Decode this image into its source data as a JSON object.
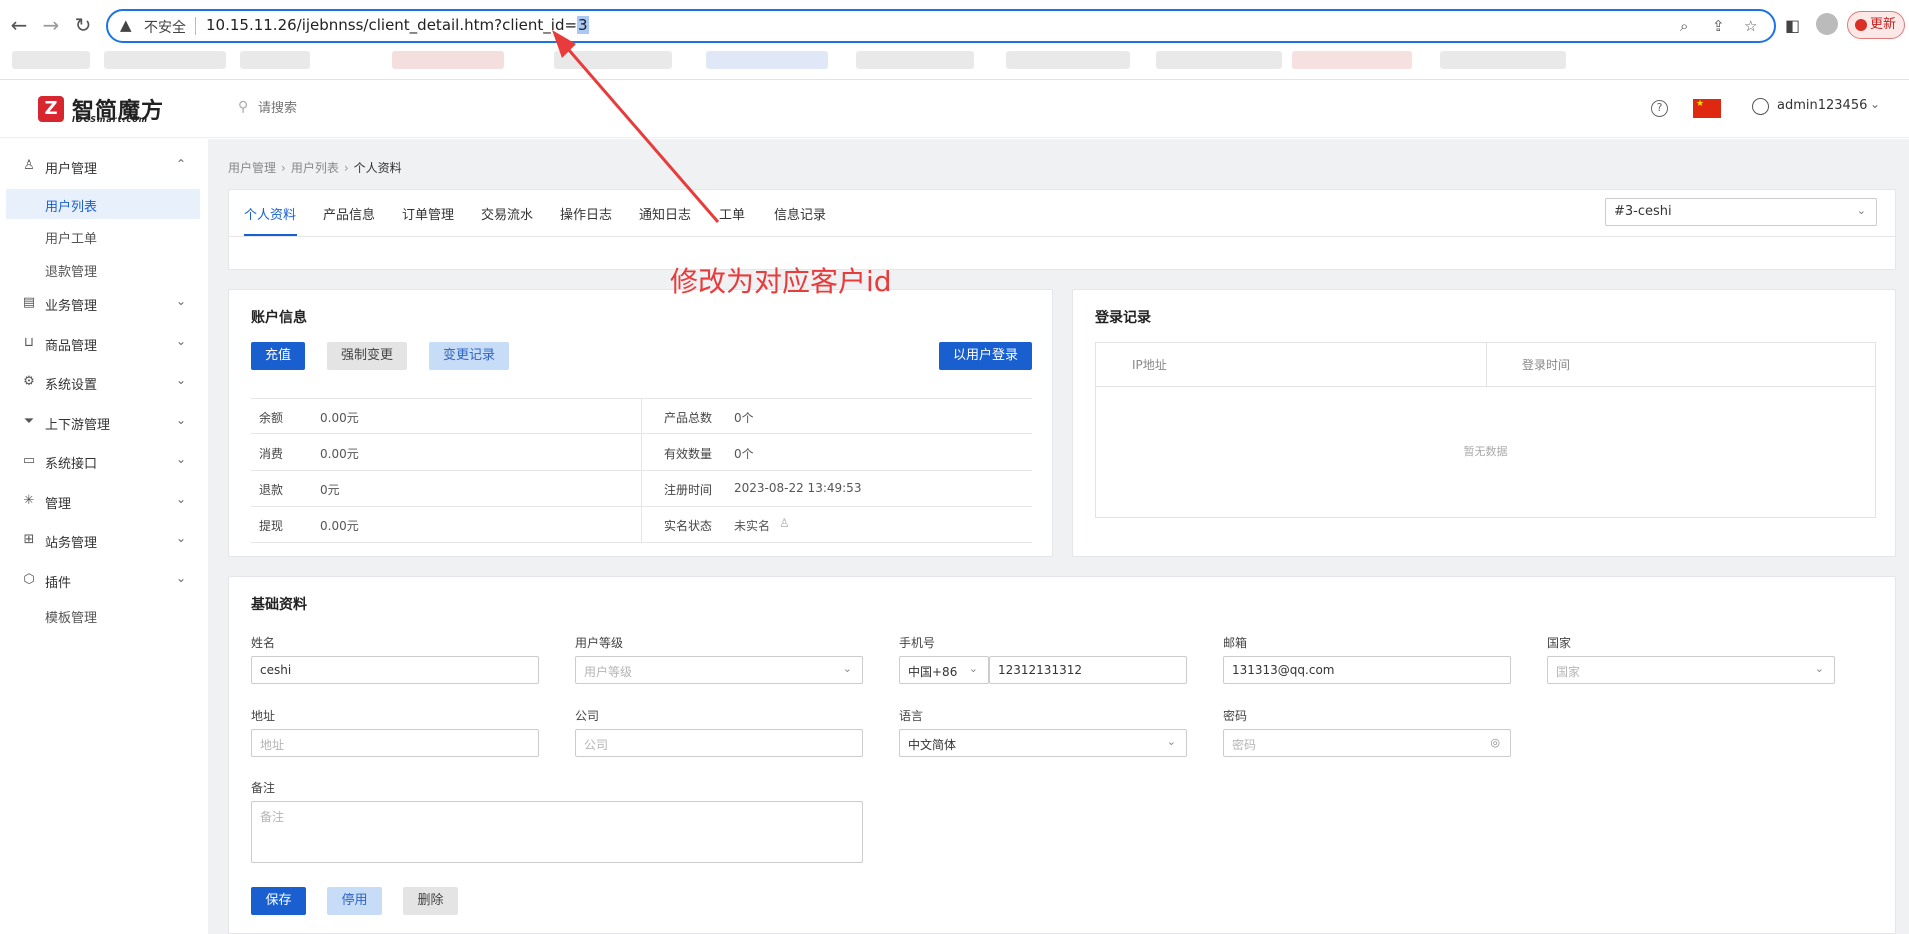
{
  "browser": {
    "insecure_label": "不安全",
    "url_prefix": "10.15.11.26/ijebnnss/client_detail.htm?client_id=",
    "url_selected": "3",
    "update_label": "更新"
  },
  "header": {
    "logo_text": "智简魔方",
    "logo_sub": "IDCSmart.com",
    "search_placeholder": "请搜索",
    "username": "admin123456"
  },
  "sidebar": {
    "user_mgmt": "用户管理",
    "user_list": "用户列表",
    "user_tickets": "用户工单",
    "refund_mgmt": "退款管理",
    "groups": [
      "业务管理",
      "商品管理",
      "系统设置",
      "上下游管理",
      "系统接口",
      "管理",
      "站务管理",
      "插件"
    ],
    "template_mgmt": "模板管理"
  },
  "breadcrumb": {
    "level1": "用户管理",
    "level2": "用户列表",
    "current": "个人资料"
  },
  "tabs": [
    "个人资料",
    "产品信息",
    "订单管理",
    "交易流水",
    "操作日志",
    "通知日志",
    "工单",
    "信息记录"
  ],
  "client_select": "#3-ceshi",
  "account": {
    "title": "账户信息",
    "btn_recharge": "充值",
    "btn_force_change": "强制变更",
    "btn_change_log": "变更记录",
    "btn_login_as": "以用户登录",
    "left": [
      {
        "k": "余额",
        "v": "0.00元"
      },
      {
        "k": "消费",
        "v": "0.00元"
      },
      {
        "k": "退款",
        "v": "0元"
      },
      {
        "k": "提现",
        "v": "0.00元"
      }
    ],
    "right": [
      {
        "k": "产品总数",
        "v": "0个"
      },
      {
        "k": "有效数量",
        "v": "0个"
      },
      {
        "k": "注册时间",
        "v": "2023-08-22 13:49:53"
      },
      {
        "k": "实名状态",
        "v": "未实名"
      }
    ]
  },
  "login": {
    "title": "登录记录",
    "col_ip": "IP地址",
    "col_time": "登录时间",
    "empty": "暂无数据"
  },
  "basic": {
    "title": "基础资料",
    "name_label": "姓名",
    "name_value": "ceshi",
    "level_label": "用户等级",
    "level_placeholder": "用户等级",
    "phone_label": "手机号",
    "phone_code": "中国+86",
    "phone_value": "12312131312",
    "email_label": "邮箱",
    "email_value": "131313@qq.com",
    "country_label": "国家",
    "country_placeholder": "国家",
    "address_label": "地址",
    "address_placeholder": "地址",
    "company_label": "公司",
    "company_placeholder": "公司",
    "language_label": "语言",
    "language_value": "中文简体",
    "password_label": "密码",
    "password_placeholder": "密码",
    "notes_label": "备注",
    "notes_placeholder": "备注",
    "btn_save": "保存",
    "btn_disable": "停用",
    "btn_delete": "删除"
  },
  "annotation": {
    "text": "修改为对应客户id",
    "color": "#e83b3b"
  }
}
